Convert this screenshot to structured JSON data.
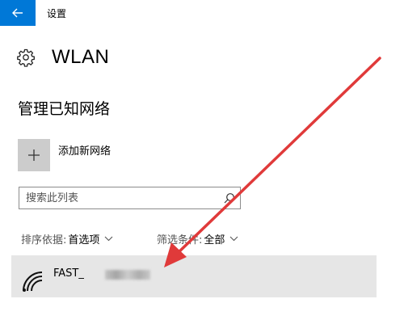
{
  "window": {
    "title": "设置"
  },
  "header": {
    "title": "WLAN",
    "icon": "gear-icon"
  },
  "section": {
    "title": "管理已知网络"
  },
  "add_network": {
    "label": "添加新网络",
    "icon": "plus-icon"
  },
  "search": {
    "placeholder": "搜索此列表",
    "value": "",
    "icon": "search-icon"
  },
  "sort": {
    "label": "排序依据:",
    "value": "首选项"
  },
  "filter": {
    "label": "筛选条件:",
    "value": "全部"
  },
  "networks": [
    {
      "name": "FAST_",
      "icon": "wifi-icon"
    }
  ],
  "colors": {
    "accent": "#0078d7",
    "annotation_arrow": "#e03a3a",
    "item_bg": "#e6e6e6",
    "tile_bg": "#cccccc"
  }
}
